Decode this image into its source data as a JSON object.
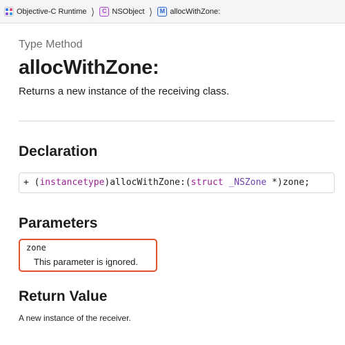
{
  "breadcrumb": {
    "items": [
      {
        "label": "Objective-C Runtime",
        "icon": "framework-icon"
      },
      {
        "label": "NSObject",
        "icon": "class-icon",
        "icon_letter": "C"
      },
      {
        "label": "allocWithZone:",
        "icon": "method-icon",
        "icon_letter": "M"
      }
    ]
  },
  "header": {
    "kind": "Type Method",
    "title": "allocWithZone:",
    "abstract": "Returns a new instance of the receiving class."
  },
  "declaration": {
    "heading": "Declaration",
    "code": {
      "prefix": "+ (",
      "keyword_instancetype": "instancetype",
      "method": ")allocWithZone:(",
      "keyword_struct": "struct",
      "space": " ",
      "type": "_NSZone",
      "suffix": " *)zone;"
    }
  },
  "parameters": {
    "heading": "Parameters",
    "items": [
      {
        "name": "zone",
        "description": "This parameter is ignored."
      }
    ]
  },
  "return_value": {
    "heading": "Return Value",
    "text": "A new instance of the receiver."
  },
  "colors": {
    "highlight_border": "#e0522c",
    "class_icon": "#a24bc2",
    "method_icon": "#2f63c9",
    "keyword": "#9b2393",
    "type": "#703daa"
  }
}
